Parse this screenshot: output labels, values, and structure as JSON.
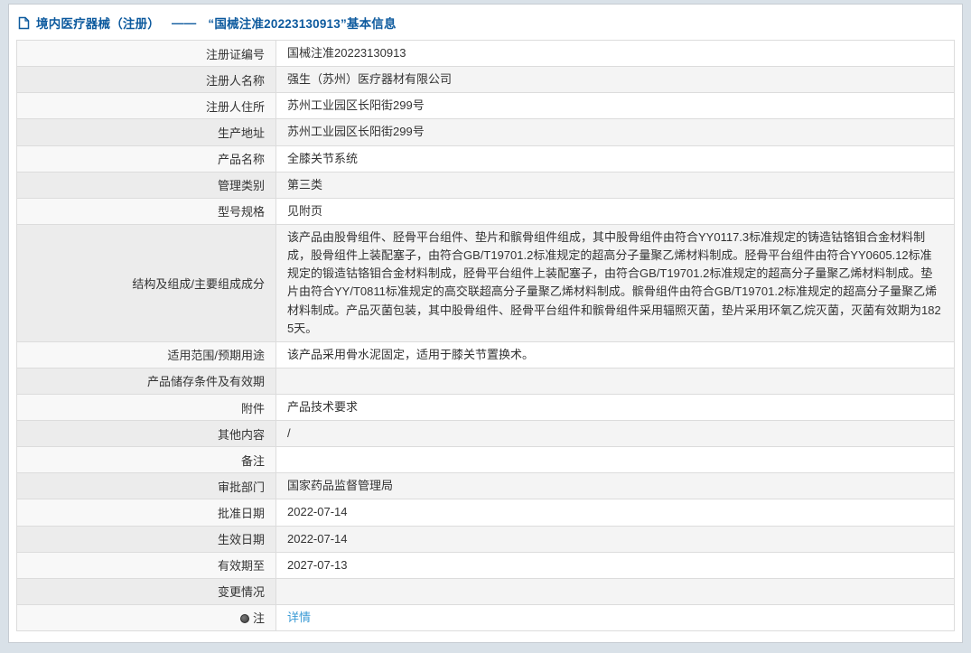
{
  "header": {
    "title_left": "境内医疗器械（注册）",
    "dash": "——",
    "title_right": "“国械注准20223130913”基本信息"
  },
  "colors": {
    "title_blue": "#0d5a9e",
    "link_blue": "#3b9bd5",
    "page_background": "#d9e1e8"
  },
  "table": {
    "rows": [
      {
        "label": "注册证编号",
        "value": "国械注准20223130913"
      },
      {
        "label": "注册人名称",
        "value": "强生（苏州）医疗器材有限公司"
      },
      {
        "label": "注册人住所",
        "value": "苏州工业园区长阳街299号"
      },
      {
        "label": "生产地址",
        "value": "苏州工业园区长阳街299号"
      },
      {
        "label": "产品名称",
        "value": "全膝关节系统"
      },
      {
        "label": "管理类别",
        "value": "第三类"
      },
      {
        "label": "型号规格",
        "value": "见附页"
      },
      {
        "label": "结构及组成/主要组成成分",
        "value": "该产品由股骨组件、胫骨平台组件、垫片和髌骨组件组成，其中股骨组件由符合YY0117.3标准规定的铸造钴铬钼合金材料制成，股骨组件上装配塞子，由符合GB/T19701.2标准规定的超高分子量聚乙烯材料制成。胫骨平台组件由符合YY0605.12标准规定的锻造钴铬钼合金材料制成，胫骨平台组件上装配塞子，由符合GB/T19701.2标准规定的超高分子量聚乙烯材料制成。垫片由符合YY/T0811标准规定的高交联超高分子量聚乙烯材料制成。髌骨组件由符合GB/T19701.2标准规定的超高分子量聚乙烯材料制成。产品灭菌包装，其中股骨组件、胫骨平台组件和髌骨组件采用辐照灭菌，垫片采用环氧乙烷灭菌，灭菌有效期为1825天。"
      },
      {
        "label": "适用范围/预期用途",
        "value": "该产品采用骨水泥固定，适用于膝关节置换术。"
      },
      {
        "label": "产品储存条件及有效期",
        "value": ""
      },
      {
        "label": "附件",
        "value": "产品技术要求"
      },
      {
        "label": "其他内容",
        "value": "/"
      },
      {
        "label": "备注",
        "value": ""
      },
      {
        "label": "审批部门",
        "value": "国家药品监督管理局"
      },
      {
        "label": "批准日期",
        "value": "2022-07-14"
      },
      {
        "label": "生效日期",
        "value": "2022-07-14"
      },
      {
        "label": "有效期至",
        "value": "2027-07-13"
      },
      {
        "label": "变更情况",
        "value": ""
      },
      {
        "label": "注",
        "value": "详情",
        "link": true,
        "icon": "note-icon"
      }
    ]
  }
}
